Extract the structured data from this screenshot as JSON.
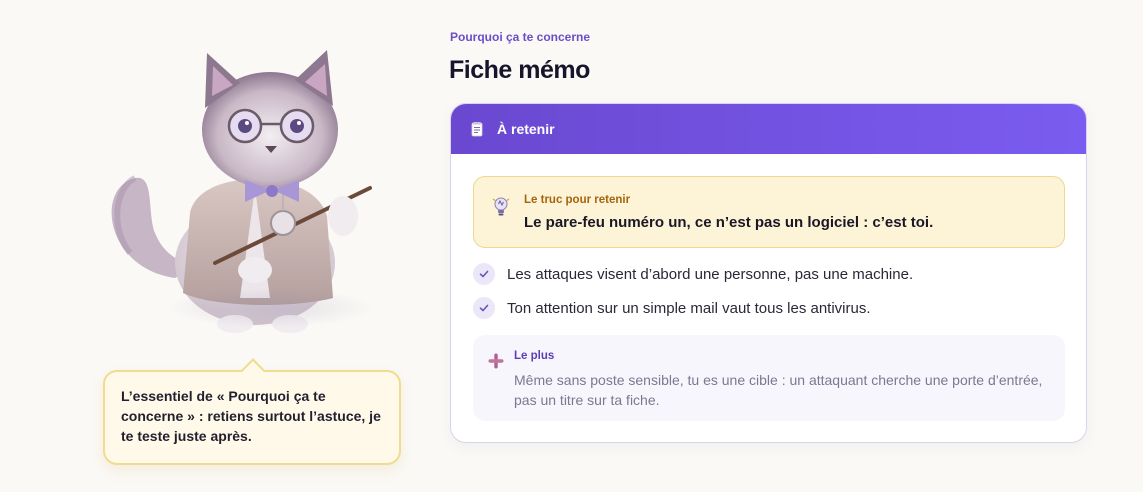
{
  "mascot": {
    "icon": "cat-teacher-mascot"
  },
  "bubble": {
    "text": "L’essentiel de « Pourquoi ça te concerne » : retiens surtout l’astuce, je te teste juste après."
  },
  "header": {
    "eyebrow": "Pourquoi ça te concerne",
    "title": "Fiche mémo"
  },
  "card": {
    "header_icon": "notepad-icon",
    "header_title": "À retenir",
    "accent": "#7254dd",
    "tip": {
      "icon": "lightbulb-icon",
      "label": "Le truc pour retenir",
      "text": "Le pare-feu numéro un, ce n’est pas un logiciel : c’est toi."
    },
    "checklist": [
      {
        "icon": "check-icon",
        "text": "Les attaques visent d’abord une personne, pas une machine."
      },
      {
        "icon": "check-icon",
        "text": "Ton attention sur un simple mail vaut tous les antivirus."
      }
    ],
    "plus": {
      "icon": "plus-icon",
      "label": "Le plus",
      "text": "Même sans poste sensible, tu es une cible : un attaquant cherche une porte d’entrée, pas un titre sur ta fiche."
    }
  }
}
